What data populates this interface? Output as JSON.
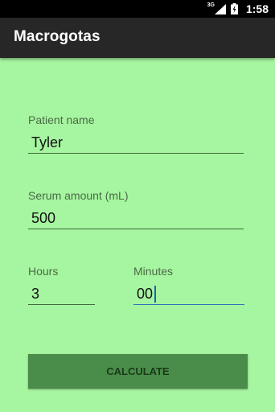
{
  "status_bar": {
    "network": "3G",
    "time": "1:58"
  },
  "app": {
    "title": "Macrogotas"
  },
  "form": {
    "patient_name": {
      "label": "Patient name",
      "value": "Tyler"
    },
    "serum_amount": {
      "label": "Serum amount (mL)",
      "value": "500"
    },
    "hours": {
      "label": "Hours",
      "value": "3"
    },
    "minutes": {
      "label": "Minutes",
      "value": "00"
    }
  },
  "actions": {
    "calculate_label": "CALCULATE"
  },
  "colors": {
    "background": "#a6f5a0",
    "action_bar": "#272727",
    "button": "#4a8d4a",
    "focus_underline": "#2b73b6"
  }
}
